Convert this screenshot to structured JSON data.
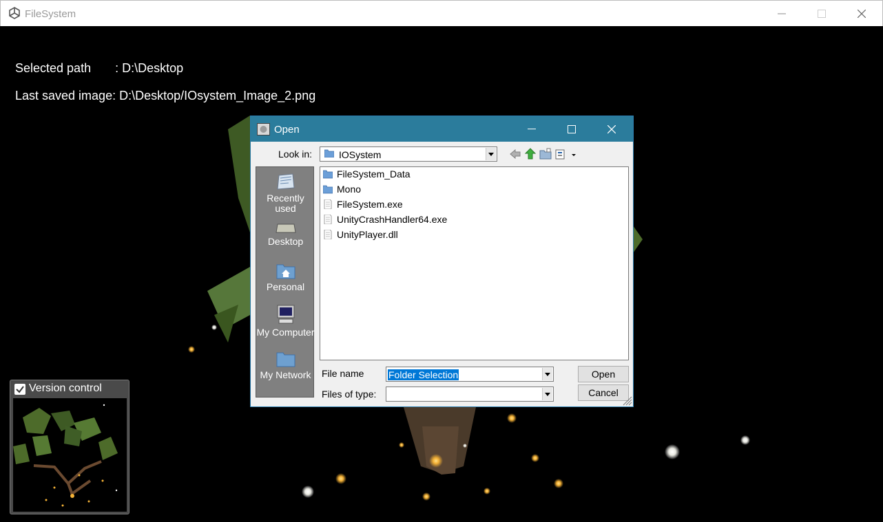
{
  "window": {
    "title": "FileSystem",
    "logo_icon": "unity-logo-icon"
  },
  "info": {
    "selected_path": "Selected path       : D:\\Desktop",
    "last_saved": "Last saved image: D:\\Desktop/IOsystem_Image_2.png"
  },
  "version_control": {
    "label": "Version control",
    "checked": true
  },
  "dialog": {
    "title": "Open",
    "look_in_label": "Look in:",
    "look_in_value": "IOSystem",
    "places": [
      {
        "label": "Recently used"
      },
      {
        "label": "Desktop"
      },
      {
        "label": "Personal"
      },
      {
        "label": "My Computer"
      },
      {
        "label": "My Network"
      }
    ],
    "files": [
      {
        "name": "FileSystem_Data",
        "type": "folder"
      },
      {
        "name": "Mono",
        "type": "folder"
      },
      {
        "name": "FileSystem.exe",
        "type": "file"
      },
      {
        "name": "UnityCrashHandler64.exe",
        "type": "file"
      },
      {
        "name": "UnityPlayer.dll",
        "type": "file"
      }
    ],
    "file_name_label": "File name",
    "file_name_value": "Folder Selection",
    "files_of_type_label": "Files of type:",
    "files_of_type_value": "",
    "open_label": "Open",
    "cancel_label": "Cancel"
  },
  "colors": {
    "dialog_title": "#2b7c9c",
    "selection": "#0078d7",
    "leaf": "#4d6b2a",
    "firefly": "#f5b236"
  }
}
